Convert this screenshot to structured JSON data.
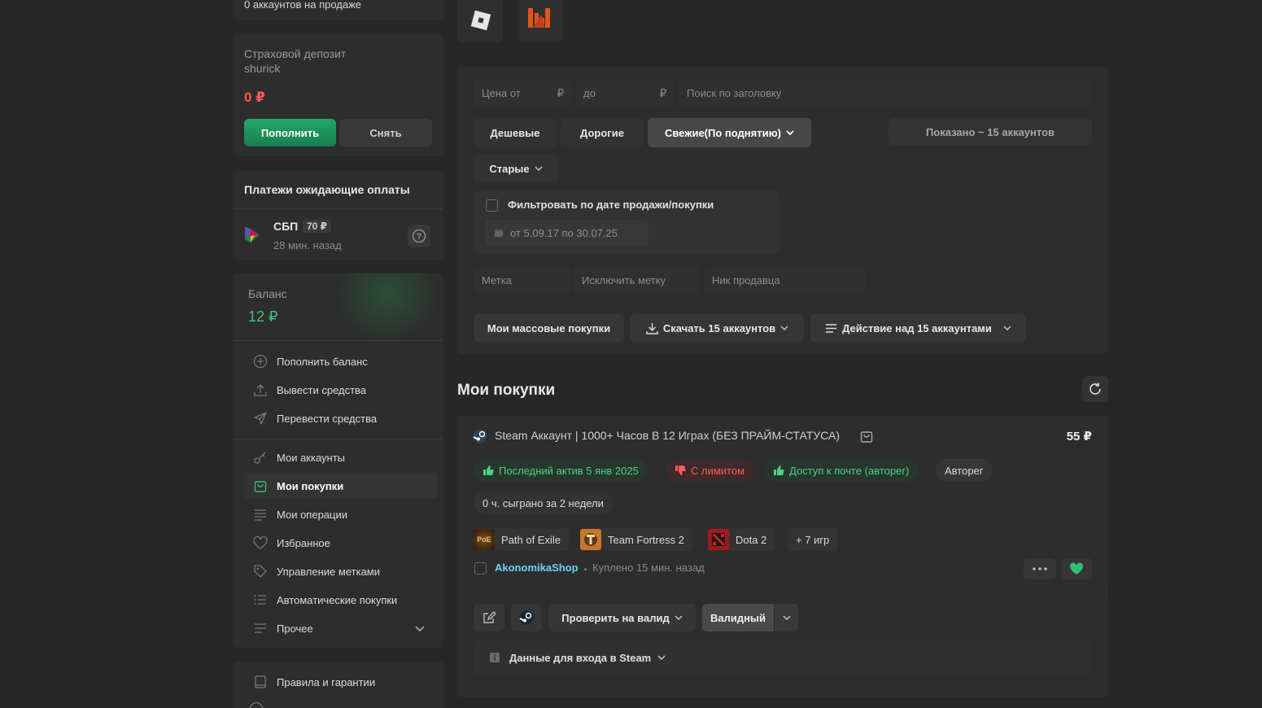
{
  "sidebar": {
    "accounts_on_sale": "0 аккаунтов на продаже",
    "deposit": {
      "title": "Страховой депозит",
      "user": "shurick",
      "amount": "0 ₽",
      "topup": "Пополнить",
      "withdraw": "Снять"
    },
    "pending": {
      "title": "Платежи ожидающие оплаты",
      "method": "СБП",
      "amount": "70 ₽",
      "time": "28 мин. назад"
    },
    "balance": {
      "label": "Баланс",
      "value": "12 ₽"
    },
    "menu": [
      {
        "label": "Пополнить баланс",
        "icon": "plus-circle-icon"
      },
      {
        "label": "Вывести средства",
        "icon": "upload-icon"
      },
      {
        "label": "Перевести средства",
        "icon": "send-icon"
      },
      {
        "label": "Мои аккаунты",
        "icon": "key-icon"
      },
      {
        "label": "Мои покупки",
        "icon": "bag-icon",
        "active": true
      },
      {
        "label": "Мои операции",
        "icon": "list-icon"
      },
      {
        "label": "Избранное",
        "icon": "heart-icon"
      },
      {
        "label": "Управление метками",
        "icon": "tag-icon"
      },
      {
        "label": "Автоматические покупки",
        "icon": "checklist-icon"
      },
      {
        "label": "Прочее",
        "icon": "lines-icon"
      }
    ],
    "rules": "Правила и гарантии"
  },
  "filters": {
    "price_from": "Цена от",
    "price_to": "до",
    "currency": "₽",
    "search_placeholder": "Поиск по заголовку",
    "sort_cheap": "Дешевые",
    "sort_expensive": "Дорогие",
    "sort_fresh": "Свежие(По поднятию)",
    "sort_old": "Старые",
    "shown": "Показано ~ 15 аккаунтов",
    "date_filter_label": "Фильтровать по дате продажи/покупки",
    "date_range": "от 5.09.17 по 30.07.25",
    "tag": "Метка",
    "exclude_tag": "Исключить метку",
    "seller_nick": "Ник продавца",
    "mass_purchases": "Мои массовые покупки",
    "download": "Скачать 15 аккаунтов",
    "action": "Действие над 15 аккаунтами"
  },
  "purchases": {
    "title": "Мои покупки",
    "item": {
      "title": "Steam Аккаунт | 1000+ Часов В 12 Играх (БЕЗ ПРАЙМ-СТАТУСА)",
      "price": "55 ₽",
      "tags": {
        "last_active": "Последний актив 5 янв 2025",
        "limit": "С лимитом",
        "mail": "Доступ к почте (авторег)",
        "autoreg": "Авторег"
      },
      "played": "0 ч. сыграно за 2 недели",
      "games": [
        "Path of Exile",
        "Team Fortress 2",
        "Dota 2"
      ],
      "more_games": "+ 7 игр",
      "seller": "AkonomikaShop",
      "bought": "Куплено 15 мин. назад",
      "check_valid": "Проверить на валид",
      "valid": "Валидный",
      "login_data": "Данные для входа в Steam"
    }
  },
  "colors": {
    "accent_green": "#1a9a5c",
    "positive": "#4cd18a",
    "negative": "#ff5a5a",
    "link": "#6fd3f5"
  }
}
